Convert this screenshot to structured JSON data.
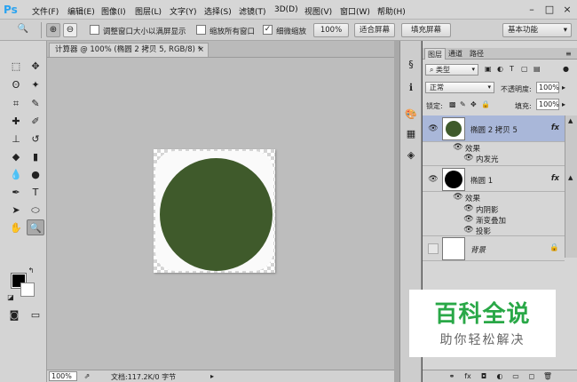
{
  "menubar": {
    "logo": "Ps",
    "items": [
      "文件(F)",
      "编辑(E)",
      "图像(I)",
      "图层(L)",
      "文字(Y)",
      "选择(S)",
      "滤镜(T)",
      "3D(D)",
      "视图(V)",
      "窗口(W)",
      "帮助(H)"
    ],
    "window_buttons": [
      "–",
      "□",
      "×"
    ]
  },
  "options": {
    "check1_label": "调整窗口大小以满屏显示",
    "check2_label": "缩放所有窗口",
    "check3_label": "细微缩放",
    "zoom_btn": "100%",
    "fit_btn": "适合屏幕",
    "fill_btn": "填充屏幕",
    "workspace": "基本功能"
  },
  "document": {
    "tab_title": "计算器 @ 100% (椭圆 2 拷贝 5, RGB/8) *",
    "tab_close": "×",
    "zoom": "100%",
    "doc_info": "文档:117.2K/0 字节"
  },
  "layers_panel": {
    "tabs": [
      "图层",
      "通道",
      "路径"
    ],
    "filter_kind": "类型",
    "blend_mode": "正常",
    "opacity_label": "不透明度:",
    "opacity_value": "100%",
    "lock_label": "锁定:",
    "fill_label": "填充:",
    "fill_value": "100%",
    "layers": [
      {
        "name": "椭圆 2 拷贝 5",
        "fx": "fx",
        "effects_label": "效果",
        "effects": [
          "内发光"
        ]
      },
      {
        "name": "椭圆 1",
        "fx": "fx",
        "effects_label": "效果",
        "effects": [
          "内阴影",
          "渐变叠加",
          "投影"
        ]
      },
      {
        "name": "背景"
      }
    ]
  },
  "watermark": {
    "title": "百科全说",
    "subtitle": "助你轻松解决"
  },
  "colors": {
    "circle_fill": "#3f5a2b",
    "selected_layer": "#a9b7d9",
    "watermark_green": "#29a847"
  }
}
